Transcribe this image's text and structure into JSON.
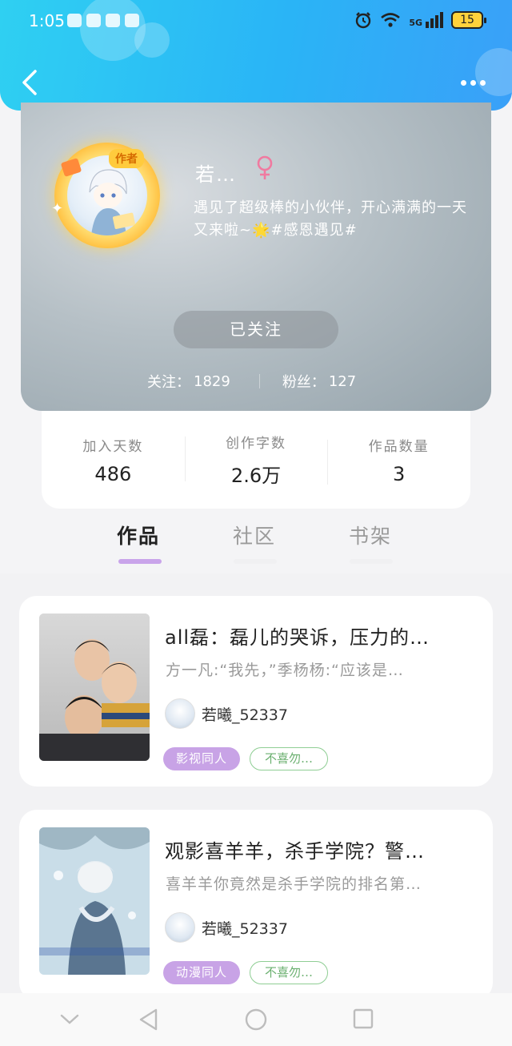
{
  "status_bar": {
    "time": "1:05",
    "network": "5G",
    "battery": "15"
  },
  "header": {
    "back_icon": "chevron-left-icon",
    "more_icon": "more-dots-icon"
  },
  "profile": {
    "author_badge": "作者",
    "username": "若…",
    "gender_icon": "female-icon",
    "bio": "遇见了超级棒的小伙伴，开心满满的一天又来啦~🌟#感恩遇见#",
    "follow_button": "已关注",
    "following_label": "关注：",
    "following_count": "1829",
    "fans_label": "粉丝：",
    "fans_count": "127"
  },
  "stats": [
    {
      "label": "加入天数",
      "value": "486"
    },
    {
      "label": "创作字数",
      "value": "2.6万"
    },
    {
      "label": "作品数量",
      "value": "3"
    }
  ],
  "tabs": [
    {
      "label": "作品",
      "active": true
    },
    {
      "label": "社区",
      "active": false
    },
    {
      "label": "书架",
      "active": false
    }
  ],
  "works": [
    {
      "title": "all磊：磊儿的哭诉，压力的…",
      "excerpt": "方一凡:“我先，”季杨杨:“应该是…",
      "author": "若曦_52337",
      "tag1": "影视同人",
      "tag2": "不喜勿…"
    },
    {
      "title": "观影喜羊羊，杀手学院？警…",
      "excerpt": "喜羊羊你竟然是杀手学院的排名第…",
      "author": "若曦_52337",
      "tag1": "动漫同人",
      "tag2": "不喜勿…"
    }
  ],
  "colors": {
    "header_gradient_start": "#2fd0f2",
    "header_gradient_end": "#3aa0f8",
    "tab_underline": "#c9a4ea",
    "tag_fill": "#c8a3e6",
    "tag_outline": "#8fce94",
    "gender": "#f07aa0"
  },
  "nav": [
    "chevron-down-icon",
    "back-triangle-icon",
    "home-circle-icon",
    "recents-square-icon"
  ]
}
